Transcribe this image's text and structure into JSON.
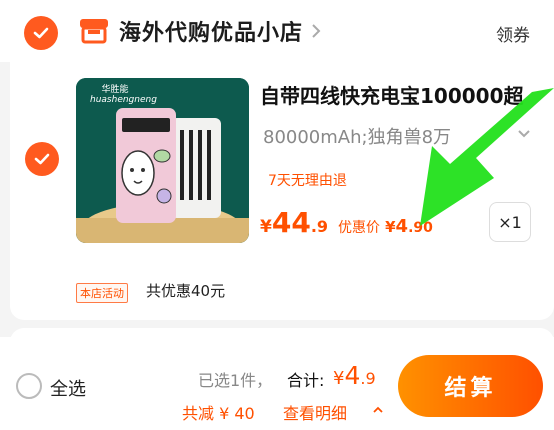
{
  "store": {
    "name": "海外代购优品小店",
    "coupon_label": "领券",
    "icon": "store-icon"
  },
  "item": {
    "thumbnail_brand_cn": "华胜能",
    "thumbnail_brand_en": "huashengneng",
    "title": "自带四线快充电宝100000超",
    "spec": "80000mAh;独角兽8万",
    "return_policy": "7天无理由退",
    "price": {
      "currency": "¥",
      "integer": "44",
      "decimal": ".9"
    },
    "discount": {
      "label": "优惠价",
      "currency": "¥",
      "integer": "4",
      "decimal": ".90"
    },
    "quantity": "×1"
  },
  "promo": {
    "tag": "本店活动",
    "text": "共优惠40元"
  },
  "bottom_bar": {
    "select_all_label": "全选",
    "selected_count": "已选1件，",
    "total_label": "合计:",
    "total": {
      "currency": "¥",
      "integer": "4",
      "decimal": ".9"
    },
    "saving_text": "共减 ¥ 40",
    "detail_link": "查看明细",
    "checkout_label": "结算"
  },
  "colors": {
    "accent": "#ff5000",
    "checkbox": "#ff5a1f",
    "annotation_arrow": "#22e01b"
  }
}
